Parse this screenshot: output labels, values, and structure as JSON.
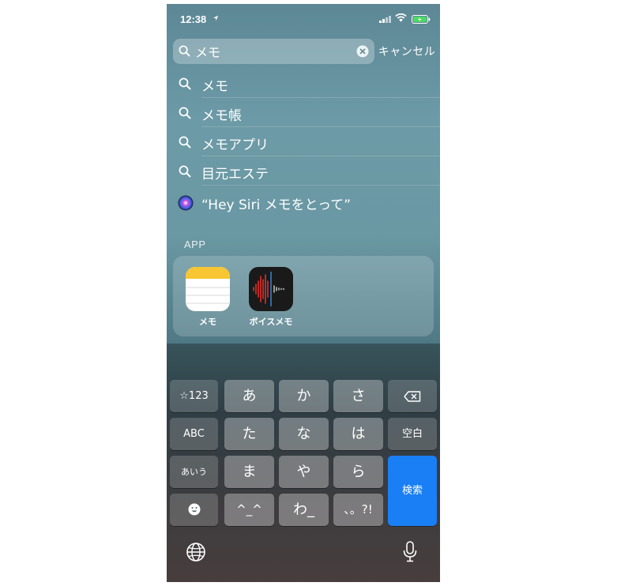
{
  "status_bar": {
    "time": "12:38"
  },
  "search": {
    "query": "メモ",
    "cancel_label": "キャンセル"
  },
  "suggestions": [
    {
      "label": "メモ"
    },
    {
      "label": "メモ帳"
    },
    {
      "label": "メモアプリ"
    },
    {
      "label": "目元エステ"
    }
  ],
  "siri_suggestion": {
    "label": "“Hey Siri メモをとって”"
  },
  "app_section": {
    "header": "APP",
    "apps": [
      {
        "name": "メモ",
        "icon": "notes-app-icon"
      },
      {
        "name": "ボイスメモ",
        "icon": "voice-memos-app-icon"
      }
    ]
  },
  "keyboard": {
    "keys": {
      "symbols": "☆123",
      "a": "あ",
      "ka": "か",
      "sa": "さ",
      "abc": "ABC",
      "ta": "た",
      "na": "な",
      "ha": "は",
      "space": "空白",
      "hiragana": "あいう",
      "ma": "ま",
      "ya": "や",
      "ra": "ら",
      "search": "検索",
      "kaomoji": "^_^",
      "wa": "わ_",
      "punct": "、。?!"
    }
  },
  "colors": {
    "search_key": "#1a7ef4",
    "notes_yellow": "#f7c632",
    "voice_red": "#e0302c"
  }
}
